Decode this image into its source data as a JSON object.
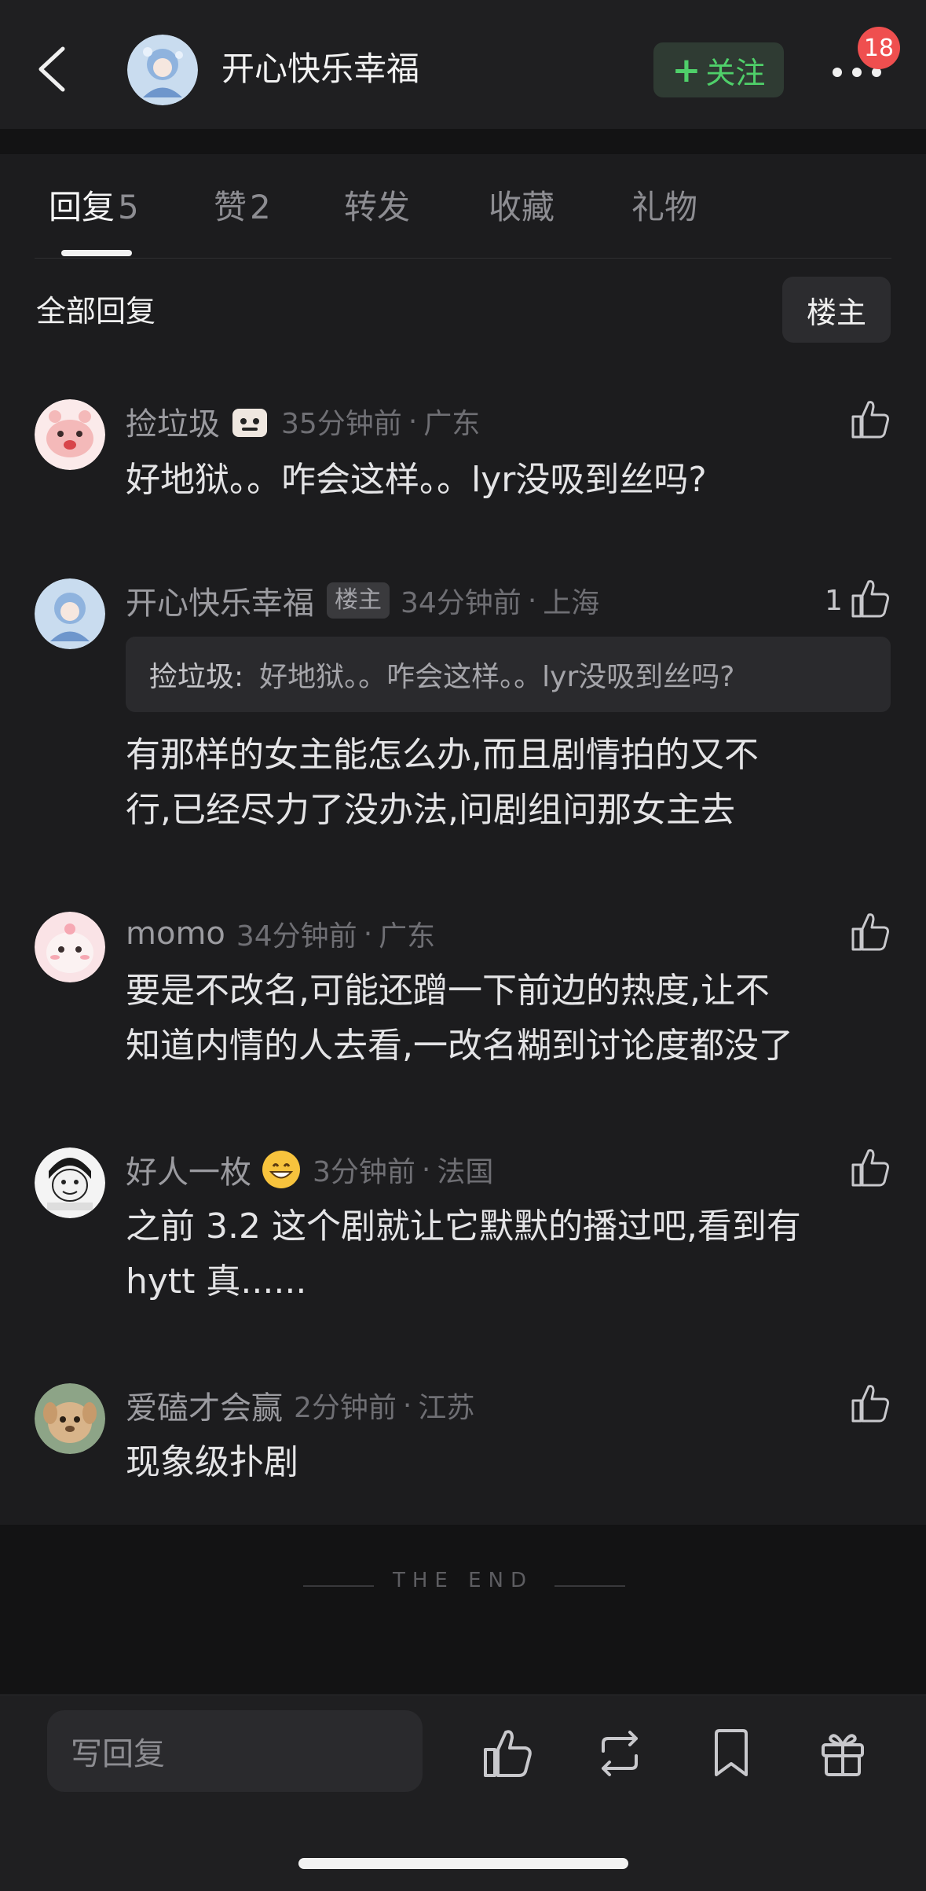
{
  "header": {
    "title": "开心快乐幸福",
    "follow_plus": "+",
    "follow_label": "关注",
    "badge_count": "18"
  },
  "tabs": [
    {
      "label": "回复",
      "count": "5"
    },
    {
      "label": "赞",
      "count": "2"
    },
    {
      "label": "转发",
      "count": ""
    },
    {
      "label": "收藏",
      "count": ""
    },
    {
      "label": "礼物",
      "count": ""
    }
  ],
  "section": {
    "title": "全部回复",
    "filter_label": "楼主"
  },
  "comments": [
    {
      "name": "捡垃圾",
      "time": "35分钟前",
      "location": "广东",
      "text": "好地狱。。咋会这样。。lyr没吸到丝吗?",
      "likes": ""
    },
    {
      "name": "开心快乐幸福",
      "tag": "楼主",
      "time": "34分钟前",
      "location": "上海",
      "quote_name": "捡垃圾:",
      "quote_text": "好地狱。。咋会这样。。lyr没吸到丝吗?",
      "text_line1": "有那样的女主能怎么办,而且剧情拍的又不",
      "text_line2": "行,已经尽力了没办法,问剧组问那女主去",
      "likes": "1"
    },
    {
      "name": "momo",
      "time": "34分钟前",
      "location": "广东",
      "text_line1": "要是不改名,可能还蹭一下前边的热度,让不",
      "text_line2": "知道内情的人去看,一改名糊到讨论度都没了",
      "likes": ""
    },
    {
      "name": "好人一枚",
      "time": "3分钟前",
      "location": "法国",
      "text_line1": "之前 3.2 这个剧就让它默默的播过吧,看到有",
      "text_line2": "hytt 真......",
      "likes": ""
    },
    {
      "name": "爱磕才会赢",
      "time": "2分钟前",
      "location": "江苏",
      "text": "现象级扑剧",
      "likes": ""
    }
  ],
  "end_text": "THE END",
  "bottom_bar": {
    "reply_placeholder": "写回复",
    "icons": [
      "like-icon",
      "repost-icon",
      "bookmark-icon",
      "gift-icon"
    ]
  },
  "colors": {
    "background": "#1c1c1e",
    "accent_green": "#4fd06a",
    "badge_red": "#ef4f4f"
  }
}
